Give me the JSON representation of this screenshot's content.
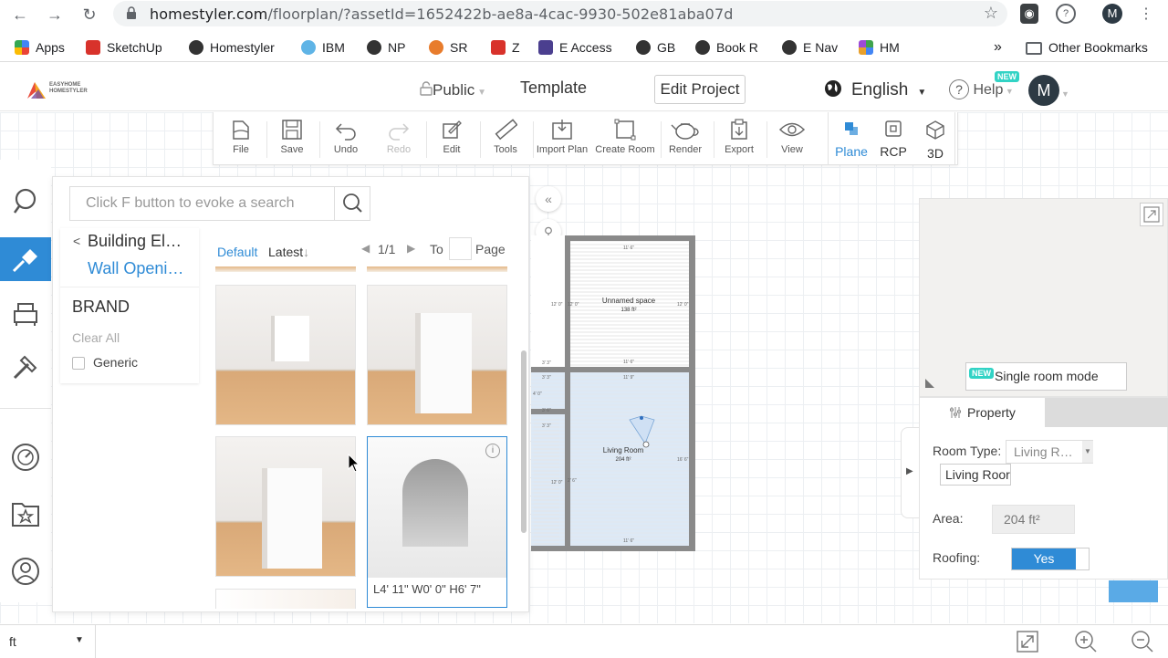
{
  "browser": {
    "url_host": "homestyler.com",
    "url_path": "/floorplan/?assetId=1652422b-ae8a-4cac-9930-502e81aba07d",
    "profile_initial": "M"
  },
  "bookmarks": {
    "items": [
      {
        "label": "Apps",
        "color": "#4285f4"
      },
      {
        "label": "SketchUp",
        "color": "#d8322b"
      },
      {
        "label": "Homestyler",
        "color": "#333333"
      },
      {
        "label": "IBM",
        "color": "#5fb4e6"
      },
      {
        "label": "NP",
        "color": "#333333"
      },
      {
        "label": "SR",
        "color": "#e87c2c"
      },
      {
        "label": "Z",
        "color": "#d8322b"
      },
      {
        "label": "E Access",
        "color": "#4b3f8f"
      },
      {
        "label": "GB",
        "color": "#333333"
      },
      {
        "label": "Book R",
        "color": "#333333"
      },
      {
        "label": "E Nav",
        "color": "#333333"
      },
      {
        "label": "HM",
        "color": "#3fa34d"
      }
    ],
    "overflow": "»",
    "other": "Other Bookmarks"
  },
  "header": {
    "logo_line1": "EASYHOME",
    "logo_line2": "HOMESTYLER",
    "visibility": "Public",
    "template": "Template",
    "edit_project": "Edit Project",
    "language": "English",
    "help": "Help",
    "new_badge": "NEW",
    "avatar_initial": "M"
  },
  "toolbar": {
    "items": [
      {
        "label": "File",
        "icon": "file-icon"
      },
      {
        "label": "Save",
        "icon": "save-icon"
      },
      {
        "label": "Undo",
        "icon": "undo-icon"
      },
      {
        "label": "Redo",
        "icon": "redo-icon"
      },
      {
        "label": "Edit",
        "icon": "edit-icon"
      },
      {
        "label": "Tools",
        "icon": "ruler-icon"
      },
      {
        "label": "Import Plan",
        "icon": "import-plan-icon"
      },
      {
        "label": "Create Room",
        "icon": "create-room-icon"
      },
      {
        "label": "Render",
        "icon": "teapot-icon"
      },
      {
        "label": "Export",
        "icon": "export-icon"
      },
      {
        "label": "View",
        "icon": "eye-icon"
      }
    ],
    "views": [
      {
        "label": "Plane",
        "active": true
      },
      {
        "label": "RCP",
        "active": false
      },
      {
        "label": "3D",
        "active": false
      }
    ]
  },
  "catalog": {
    "search_placeholder": "Click F button to evoke a search",
    "back": "<",
    "parent_category": "Building El…",
    "current_category": "Wall Openi…",
    "brand_title": "BRAND",
    "clear_all": "Clear All",
    "brand_option": "Generic",
    "sort_default": "Default",
    "sort_latest": "Latest",
    "page_indicator": "1/1",
    "page_to": "To",
    "page_suffix": "Page",
    "selected_item_dims": "L4' 11\" W0' 0\" H6' 7\""
  },
  "floorplan": {
    "room1_name": "Unnamed space",
    "room1_area": "138 ft²",
    "room2_name": "Living Room",
    "room2_area": "204 ft²",
    "dim_top": "11' 6\"",
    "dim_side": "12' 0\"",
    "dim_side2": "16' 6\"",
    "dim_small": "3' 3\"",
    "dim_small2": "3' 6\"",
    "dim_small3": "4' 0\"",
    "dim_small4": "2' 6\"",
    "dim_small5": "11' 9\""
  },
  "property": {
    "single_room_mode": "Single room mode",
    "new_badge": "NEW",
    "title": "Property",
    "room_type_label": "Room Type:",
    "room_type_value": "Living R…",
    "room_name_value": "Living Roor",
    "area_label": "Area:",
    "area_value": "204 ft²",
    "roofing_label": "Roofing:",
    "roofing_value": "Yes"
  },
  "bottom": {
    "unit": "ft"
  },
  "colors": {
    "accent": "#2f8bd6",
    "new_badge": "#32d3c5"
  }
}
